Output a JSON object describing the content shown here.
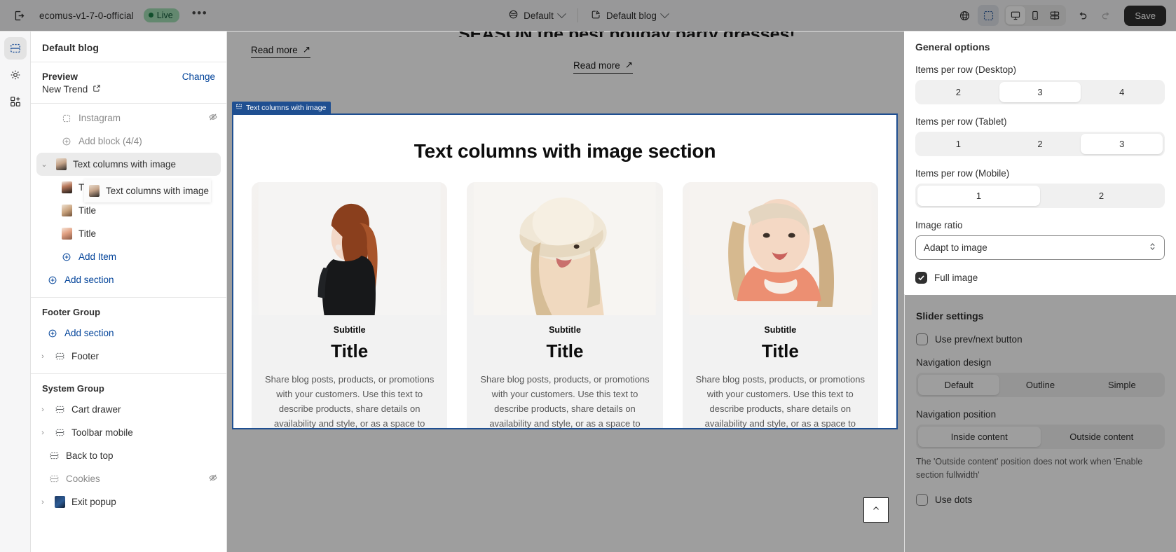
{
  "topbar": {
    "exit_icon": "exit-icon",
    "shop_name": "ecomus-v1-7-0-official",
    "status_badge": "Live",
    "more_label": "•••",
    "theme_selector": "Default",
    "page_selector": "Default blog",
    "save_label": "Save",
    "icons": {
      "inspector": "code-inspector-icon",
      "select": "pointer-select-icon",
      "desktop": "desktop-icon",
      "mobile": "mobile-icon",
      "fullscreen": "fullscreen-icon",
      "undo": "undo-icon",
      "redo": "redo-icon"
    }
  },
  "rail": {
    "items": [
      {
        "name": "sections-icon",
        "active": true
      },
      {
        "name": "settings-gear-icon",
        "active": false
      },
      {
        "name": "apps-add-icon",
        "active": false
      }
    ]
  },
  "sidebar": {
    "title": "Default blog",
    "preview_label": "Preview",
    "change_label": "Change",
    "preview_value": "New Trend",
    "drag_ghost_label": "Text columns with image",
    "items": [
      {
        "label": "Instagram",
        "icon": "block-icon",
        "muted": true,
        "hidden": true,
        "indent": true
      },
      {
        "label": "Add block (4/4)",
        "icon": "plus-circle-icon",
        "muted": true,
        "indent": true
      },
      {
        "label": "Text columns with image",
        "icon": "image-thumb-icon",
        "selected": true,
        "expandable": true
      },
      {
        "label": "Title",
        "icon": "image-thumb-icon",
        "indent": true
      },
      {
        "label": "Title",
        "icon": "image-thumb-icon",
        "indent": true
      },
      {
        "label": "Title",
        "icon": "image-thumb-icon",
        "indent": true
      },
      {
        "label": "Add Item",
        "icon": "plus-circle-icon",
        "link": true,
        "indent": true
      },
      {
        "label": "Add section",
        "icon": "plus-circle-icon",
        "link": true
      }
    ],
    "footer_group": {
      "title": "Footer Group",
      "add_section": "Add section",
      "items": [
        {
          "label": "Footer",
          "icon": "section-icon",
          "expandable": true
        }
      ]
    },
    "system_group": {
      "title": "System Group",
      "items": [
        {
          "label": "Cart drawer",
          "icon": "section-icon",
          "expandable": true
        },
        {
          "label": "Toolbar mobile",
          "icon": "section-icon",
          "expandable": true
        },
        {
          "label": "Back to top",
          "icon": "section-icon"
        },
        {
          "label": "Cookies",
          "icon": "section-icon",
          "muted": true,
          "hidden": true
        },
        {
          "label": "Exit popup",
          "icon": "image-thumb-icon",
          "expandable": true
        }
      ]
    }
  },
  "preview": {
    "partial_headline": "SEASON the best holiday party dresses!",
    "read_more_1": "Read more",
    "read_more_2": "Read more",
    "section_tab_label": "Text columns with image",
    "section_heading": "Text columns with image section",
    "cards": [
      {
        "subtitle": "Subtitle",
        "title": "Title",
        "text": "Share blog posts, products, or promotions with your customers. Use this text to describe products, share details on availability and style, or as a space to display recent reviews or FAQs."
      },
      {
        "subtitle": "Subtitle",
        "title": "Title",
        "text": "Share blog posts, products, or promotions with your customers. Use this text to describe products, share details on availability and style, or as a space to display recent reviews or FAQs."
      },
      {
        "subtitle": "Subtitle",
        "title": "Title",
        "text": "Share blog posts, products, or promotions with your customers. Use this text to describe products, share details on availability and style, or as a space to display recent reviews or FAQs."
      }
    ],
    "back_to_top_icon": "chevron-up-icon"
  },
  "settings": {
    "general_title": "General options",
    "desktop_label": "Items per row (Desktop)",
    "desktop_options": [
      "2",
      "3",
      "4"
    ],
    "desktop_selected": "3",
    "tablet_label": "Items per row (Tablet)",
    "tablet_options": [
      "1",
      "2",
      "3"
    ],
    "tablet_selected": "3",
    "mobile_label": "Items per row (Mobile)",
    "mobile_options": [
      "1",
      "2"
    ],
    "mobile_selected": "1",
    "image_ratio_label": "Image ratio",
    "image_ratio_value": "Adapt to image",
    "full_image_label": "Full image",
    "full_image_checked": true,
    "slider_title": "Slider settings",
    "prev_next_label": "Use prev/next button",
    "prev_next_checked": false,
    "nav_design_label": "Navigation design",
    "nav_design_options": [
      "Default",
      "Outline",
      "Simple"
    ],
    "nav_design_selected": "Default",
    "nav_position_label": "Navigation position",
    "nav_position_options": [
      "Inside content",
      "Outside content"
    ],
    "nav_position_selected": "Inside content",
    "nav_hint": "The 'Outside content' position does not work when 'Enable section fullwidth'",
    "use_dots_label": "Use dots",
    "use_dots_checked": false
  },
  "colors": {
    "accent_blue": "#1f4f91",
    "link_blue": "#004299",
    "live_green": "#a0dcb4",
    "save_dark": "#303030"
  }
}
